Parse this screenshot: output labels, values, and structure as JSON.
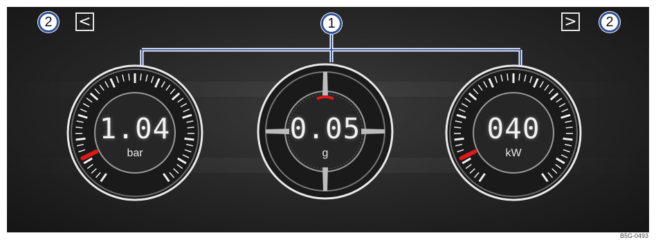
{
  "callouts": {
    "center": "1",
    "left": "2",
    "right": "2"
  },
  "navigation": {
    "prev_glyph": "<",
    "next_glyph": ">"
  },
  "gauges": [
    {
      "id": "boost-pressure",
      "value": "1.04",
      "unit": "bar",
      "needle_level": 0.1
    },
    {
      "id": "g-force",
      "value": "0.05",
      "unit": "g"
    },
    {
      "id": "power",
      "value": "040",
      "unit": "kW",
      "needle_level": 0.1
    }
  ],
  "colors": {
    "callout_border": "#2f4f9c",
    "connector": "#3d62b8",
    "needle": "#e01818",
    "bezel": "#e9e9e9"
  },
  "image_code": "B5G-0493"
}
